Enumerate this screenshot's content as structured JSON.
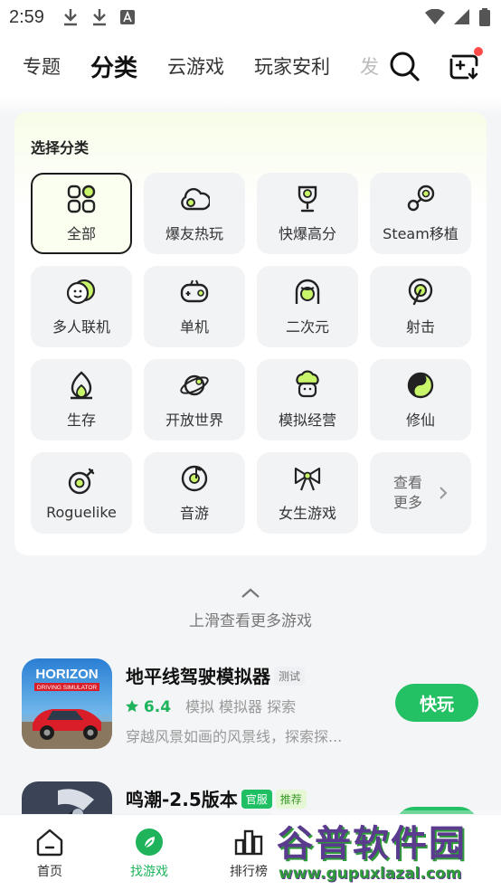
{
  "status_bar": {
    "time": "2:59",
    "icons": [
      "download-icon",
      "download-icon",
      "a-icon"
    ],
    "right_icons": [
      "wifi-icon",
      "signal-icon",
      "battery-icon"
    ]
  },
  "top_tabs": [
    {
      "label": "专题"
    },
    {
      "label": "分类",
      "active": true
    },
    {
      "label": "云游戏"
    },
    {
      "label": "玩家安利"
    },
    {
      "label": "发"
    }
  ],
  "category_section": {
    "title": "选择分类",
    "items": [
      {
        "label": "全部",
        "icon": "grid-icon",
        "selected": true
      },
      {
        "label": "爆友热玩",
        "icon": "cloud-icon"
      },
      {
        "label": "快爆高分",
        "icon": "trophy-icon"
      },
      {
        "label": "Steam移植",
        "icon": "steam-icon"
      },
      {
        "label": "多人联机",
        "icon": "faces-icon"
      },
      {
        "label": "单机",
        "icon": "gamepad-icon"
      },
      {
        "label": "二次元",
        "icon": "anime-girl-icon"
      },
      {
        "label": "射击",
        "icon": "target-icon"
      },
      {
        "label": "生存",
        "icon": "flame-icon"
      },
      {
        "label": "开放世界",
        "icon": "planet-icon"
      },
      {
        "label": "模拟经营",
        "icon": "chef-icon"
      },
      {
        "label": "修仙",
        "icon": "yin-yang-icon"
      },
      {
        "label": "Roguelike",
        "icon": "meat-icon"
      },
      {
        "label": "音游",
        "icon": "music-disc-icon"
      },
      {
        "label": "女生游戏",
        "icon": "bow-icon"
      }
    ],
    "more_label": "查看更多"
  },
  "swipe_hint": "上滑查看更多游戏",
  "games": [
    {
      "name": "地平线驾驶模拟器",
      "badges": [
        {
          "text": "测试",
          "style": "gray"
        }
      ],
      "score": "6.4",
      "tags": "模拟  模拟器  探索",
      "desc": "穿越风景如画的风景线，探索探...",
      "button": "快玩",
      "thumb_text": "HORIZON",
      "thumb_subtext": "DRIVING SIMULATOR"
    },
    {
      "name": "鸣潮-2.5版本",
      "badges": [
        {
          "text": "官服",
          "style": "green"
        },
        {
          "text": "推荐",
          "style": "lime"
        }
      ],
      "button": ""
    }
  ],
  "bottom_nav": [
    {
      "label": "首页",
      "icon": "home-icon"
    },
    {
      "label": "找游戏",
      "icon": "leaf-compass-icon",
      "active": true
    },
    {
      "label": "排行榜",
      "icon": "bar-chart-icon"
    }
  ],
  "watermark": {
    "main": "谷普软件园",
    "url": "www.gupuxlazal.com"
  },
  "colors": {
    "accent": "#24c064",
    "highlight": "#c8f56a",
    "text": "#222222"
  }
}
